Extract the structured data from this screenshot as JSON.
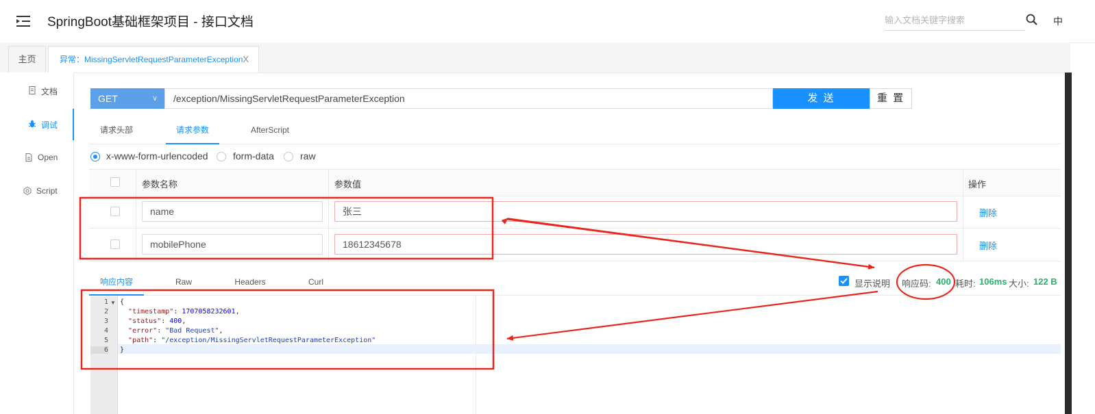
{
  "header": {
    "title": "SpringBoot基础框架项目 - 接口文档",
    "search_placeholder": "输入文档关键字搜索",
    "lang": "中"
  },
  "tabs": {
    "home": "主页",
    "active": "异常：MissingServletRequestParameterException",
    "close": "X"
  },
  "sidebar": {
    "items": [
      {
        "label": "文档",
        "icon": "document-icon"
      },
      {
        "label": "调试",
        "icon": "bug-icon"
      },
      {
        "label": "Open",
        "icon": "file-icon"
      },
      {
        "label": "Script",
        "icon": "code-icon"
      }
    ]
  },
  "request": {
    "method": "GET",
    "url": "/exception/MissingServletRequestParameterException",
    "send_label": "发 送",
    "reset_label": "重 置"
  },
  "request_tabs": [
    "请求头部",
    "请求参数",
    "AfterScript"
  ],
  "body_types": [
    "x-www-form-urlencoded",
    "form-data",
    "raw"
  ],
  "params_table": {
    "headers": [
      "参数名称",
      "参数值",
      "操作"
    ],
    "rows": [
      {
        "name": "name",
        "value": "张三",
        "action": "删除"
      },
      {
        "name": "mobilePhone",
        "value": "18612345678",
        "action": "删除"
      }
    ]
  },
  "response_tabs": [
    "响应内容",
    "Raw",
    "Headers",
    "Curl"
  ],
  "response_meta": {
    "show_desc": "显示说明",
    "code_label": "响应码:",
    "code": "400",
    "time_label": "耗时:",
    "time": "106ms",
    "size_label": "大小:",
    "size": "122 B"
  },
  "response_body": {
    "line_numbers": [
      "1",
      "2",
      "3",
      "4",
      "5",
      "6"
    ],
    "lines": [
      {
        "k": "\"timestamp\"",
        "v": "1707058232601",
        "vt": "num"
      },
      {
        "k": "\"status\"",
        "v": "400",
        "vt": "num"
      },
      {
        "k": "\"error\"",
        "v": "\"Bad Request\"",
        "vt": "str"
      },
      {
        "k": "\"path\"",
        "v": "\"/exception/MissingServletRequestParameterException\"",
        "vt": "str"
      }
    ],
    "open_brace": "{",
    "close_brace": "}"
  },
  "colors": {
    "accent": "#1890ff",
    "annotation": "#e8261d",
    "status_green": "#27b36b"
  }
}
